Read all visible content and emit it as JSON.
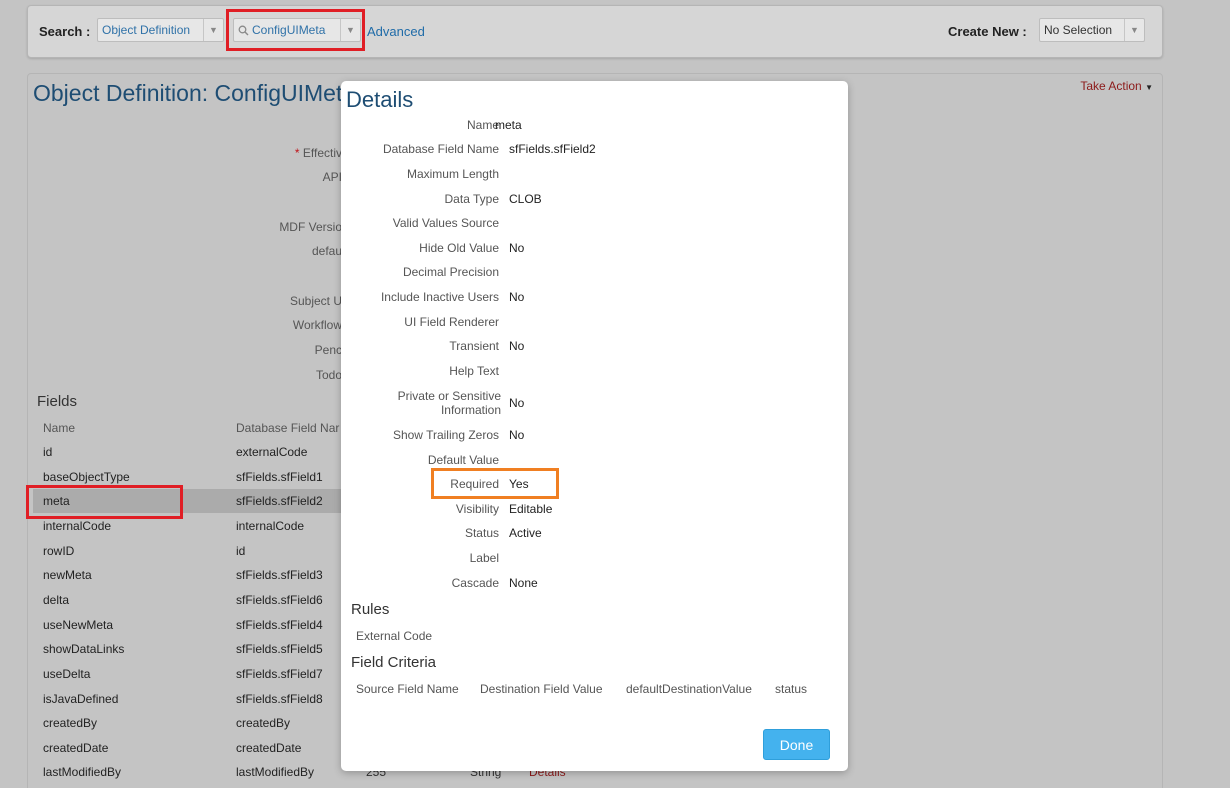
{
  "topbar": {
    "search_label": "Search :",
    "search_type": "Object Definition",
    "search_object": "ConfigUIMeta",
    "advanced_link": "Advanced",
    "create_new_label": "Create New :",
    "create_new_value": "No Selection"
  },
  "page": {
    "title": "Object Definition: ConfigUIMet",
    "take_action": "Take Action",
    "meta_labels": [
      "Effectiv",
      "API",
      "MDF Versio",
      "defau",
      "Subject U",
      "Workflow",
      "Penc",
      "Todo"
    ],
    "required_marker": "*"
  },
  "fields": {
    "title": "Fields",
    "columns": [
      "Name",
      "Database Field Nar"
    ],
    "rows": [
      {
        "name": "id",
        "db": "externalCode"
      },
      {
        "name": "baseObjectType",
        "db": "sfFields.sfField1"
      },
      {
        "name": "meta",
        "db": "sfFields.sfField2"
      },
      {
        "name": "internalCode",
        "db": "internalCode"
      },
      {
        "name": "rowID",
        "db": "id"
      },
      {
        "name": "newMeta",
        "db": "sfFields.sfField3"
      },
      {
        "name": "delta",
        "db": "sfFields.sfField6"
      },
      {
        "name": "useNewMeta",
        "db": "sfFields.sfField4"
      },
      {
        "name": "showDataLinks",
        "db": "sfFields.sfField5"
      },
      {
        "name": "useDelta",
        "db": "sfFields.sfField7"
      },
      {
        "name": "isJavaDefined",
        "db": "sfFields.sfField8"
      },
      {
        "name": "createdBy",
        "db": "createdBy"
      },
      {
        "name": "createdDate",
        "db": "createdDate"
      },
      {
        "name": "lastModifiedBy",
        "db": "lastModifiedBy"
      }
    ],
    "last_row_extra": {
      "length": "255",
      "type": "String",
      "link": "Details"
    }
  },
  "modal": {
    "title": "Details",
    "details": [
      {
        "label": "Name",
        "value": "meta"
      },
      {
        "label": "Database Field Name",
        "value": "sfFields.sfField2"
      },
      {
        "label": "Maximum Length",
        "value": ""
      },
      {
        "label": "Data Type",
        "value": "CLOB"
      },
      {
        "label": "Valid Values Source",
        "value": ""
      },
      {
        "label": "Hide Old Value",
        "value": "No"
      },
      {
        "label": "Decimal Precision",
        "value": ""
      },
      {
        "label": "Include Inactive Users",
        "value": "No"
      },
      {
        "label": "UI Field Renderer",
        "value": ""
      },
      {
        "label": "Transient",
        "value": "No"
      },
      {
        "label": "Help Text",
        "value": ""
      },
      {
        "label": "Private or Sensitive Information",
        "value": "No"
      },
      {
        "label": "Show Trailing Zeros",
        "value": "No"
      },
      {
        "label": "Default Value",
        "value": ""
      },
      {
        "label": "Required",
        "value": "Yes"
      },
      {
        "label": "Visibility",
        "value": "Editable"
      },
      {
        "label": "Status",
        "value": "Active"
      },
      {
        "label": "Label",
        "value": ""
      },
      {
        "label": "Cascade",
        "value": "None"
      }
    ],
    "rules_title": "Rules",
    "rules_columns": [
      "External Code"
    ],
    "criteria_title": "Field Criteria",
    "criteria_columns": [
      "Source Field Name",
      "Destination Field Value",
      "defaultDestinationValue",
      "status"
    ],
    "done_label": "Done"
  },
  "colors": {
    "highlight_red": "#e01e25",
    "highlight_orange": "#f07f22",
    "done_button": "#44b2ee",
    "title_blue": "#1e4d73"
  }
}
